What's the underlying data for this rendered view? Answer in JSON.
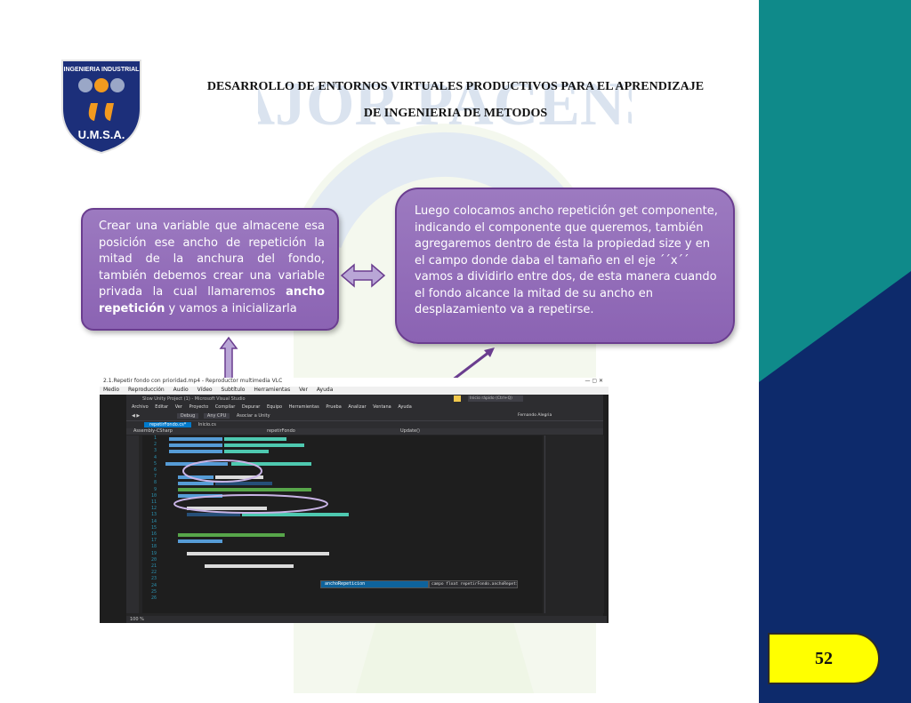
{
  "header": {
    "line1": "DESARROLLO DE ENTORNOS VIRTUALES PRODUCTIVOS PARA EL APRENDIZAJE",
    "line2": "DE INGENIERIA DE METODOS"
  },
  "logo": {
    "top_text": "INGENIERIA INDUSTRIAL",
    "bottom_text": "U.M.S.A."
  },
  "watermark": {
    "text": "MAJOR PACENSIS"
  },
  "left_callout": {
    "text_before": "Crear una variable que almacene esa posición ese ancho de repetición la mitad de la anchura del fondo, también debemos crear una variable privada la cual llamaremos ",
    "bold": "ancho repetición",
    "text_after": " y vamos a inicializarla"
  },
  "right_callout": {
    "text": "Luego colocamos ancho repetición get componente, indicando el componente que queremos, también agregaremos dentro de ésta la propiedad size y en el campo donde daba el tamaño en el eje ´´x´´ vamos a dividirlo entre dos, de esta manera cuando el fondo alcance la mitad de su ancho en desplazamiento va a repetirse."
  },
  "page_number": "52",
  "screenshot": {
    "player_title": "2.1.Repetir fondo con prioridad.mp4 - Reproductor multimedia VLC",
    "player_menu": [
      "Medio",
      "Reproducción",
      "Audio",
      "Vídeo",
      "Subtítulo",
      "Herramientas",
      "Ver",
      "Ayuda"
    ],
    "vs_title": "Slow Unity Project (1) - Microsoft Visual Studio",
    "vs_menu": [
      "Archivo",
      "Editar",
      "Ver",
      "Proyecto",
      "Compilar",
      "Depurar",
      "Equipo",
      "Herramientas",
      "Prueba",
      "Analizar",
      "Ventana",
      "Ayuda"
    ],
    "vs_search": "Inicio rápido (Ctrl+Q)",
    "vs_user": "Fernando Alegria",
    "toolbar_config": "Debug",
    "toolbar_platform": "Any CPU",
    "toolbar_attach": "Asociar a Unity",
    "tabs": [
      "repetirFondo.cs*",
      "Inicio.cs"
    ],
    "nav": [
      "Assembly-CSharp",
      "repetirFondo",
      "Update()"
    ],
    "line_numbers": [
      "1",
      "2",
      "3",
      "4",
      "5",
      "6",
      "7",
      "8",
      "9",
      "10",
      "11",
      "12",
      "13",
      "14",
      "15",
      "16",
      "17",
      "18",
      "19",
      "20",
      "21",
      "22",
      "23",
      "24",
      "25",
      "26"
    ],
    "intellisense_item": "anchoRepeticion",
    "tooltip": "campo float repetirFondo.anchoRepeticion",
    "zoom": "100 %"
  },
  "colors": {
    "band_teal": "#0f8a8a",
    "band_navy": "#0d2a6b",
    "callout_fill": "#9170b8",
    "badge_yellow": "#ffff00"
  }
}
